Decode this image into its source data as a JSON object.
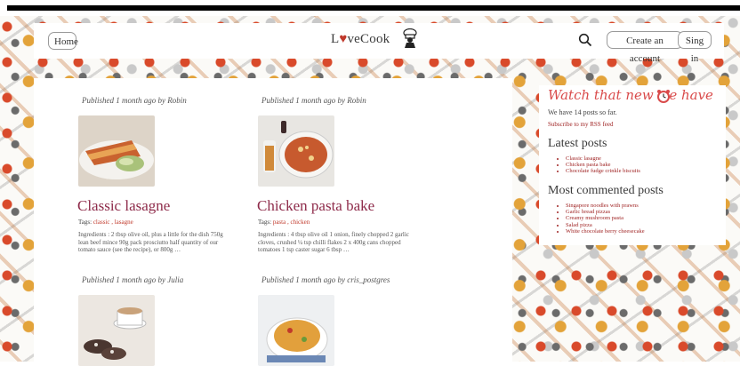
{
  "header": {
    "home_label": "Home",
    "logo_text_l": "L",
    "logo_text_heart": "♥",
    "logo_text_rest": "veCook",
    "create_account_label": "Create an account",
    "sign_in_label": "Sing in"
  },
  "posts": [
    {
      "meta": "Published 1 month ago by Robin",
      "title": "Classic lasagne",
      "tags_label": "Tags:",
      "tags": "classic , lasagne",
      "description": "Ingredients : 2 tbsp olive oil, plus a little for the dish 750g lean beef mince 90g pack prosciutto half quantity of our tomato sauce (see the recipe), or 800g …"
    },
    {
      "meta": "Published 1 month ago by Robin",
      "title": "Chicken pasta bake",
      "tags_label": "Tags:",
      "tags": "pasta , chicken",
      "description": "Ingredients : 4 tbsp olive oil 1 onion, finely chopped 2 garlic cloves, crushed ¼ tsp chilli flakes 2 x 400g cans chopped tomatoes 1 tsp caster sugar 6 tbsp …"
    },
    {
      "meta": "Published 1 month ago by Julia"
    },
    {
      "meta": "Published 1 month ago by cris_postgres"
    }
  ],
  "sidebar": {
    "watch_title": "Watch that new we have",
    "count_text": "We have 14 posts so far.",
    "rss_text": "Subscribe to my RSS feed",
    "latest_heading": "Latest posts",
    "latest": [
      "Classic lasagne",
      "Chicken pasta bake",
      "Chocolate fudge crinkle biscuits"
    ],
    "commented_heading": "Most commented posts",
    "commented": [
      "Singapore noodles with prawns",
      "Garlic bread pizzas",
      "Creamy mushroom pasta",
      "Salad pizza",
      "White chocolate berry cheesecake"
    ]
  },
  "colors": {
    "title": "#8e2b4a",
    "accent": "#d94b4b",
    "link": "#a02525"
  }
}
